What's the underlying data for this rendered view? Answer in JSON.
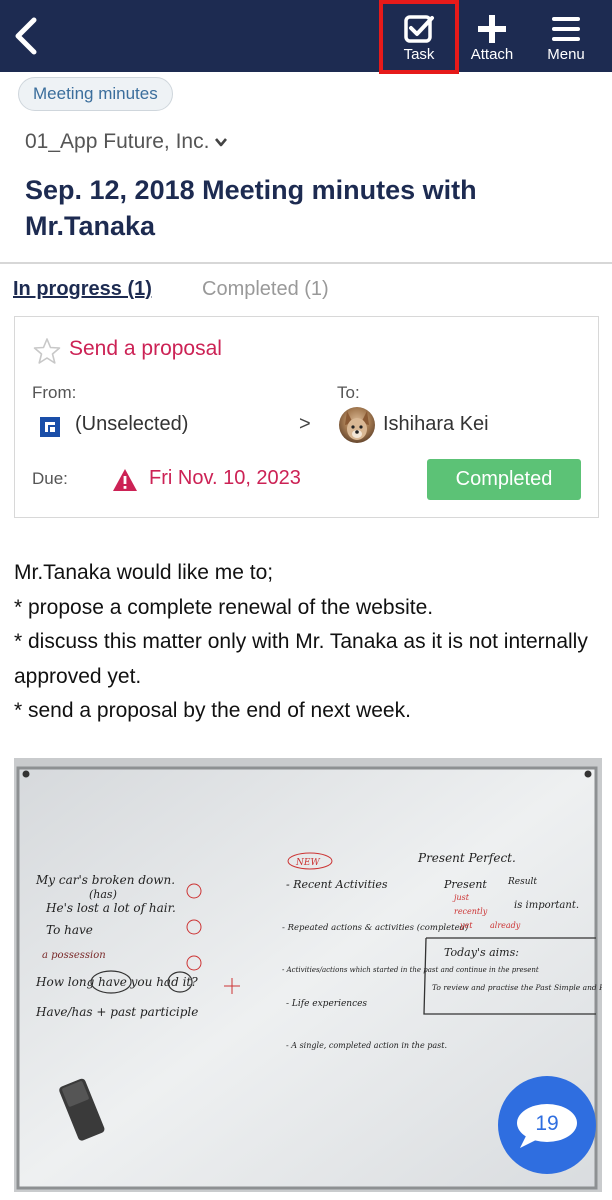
{
  "header": {
    "back_icon": "chevron-left-icon",
    "task_label": "Task",
    "attach_label": "Attach",
    "menu_label": "Menu",
    "background_color": "#1d2b51",
    "highlight_color": "#e61a1a"
  },
  "tag": "Meeting minutes",
  "company": "01_App Future, Inc.",
  "title": "Sep. 12, 2018 Meeting minutes with Mr.Tanaka",
  "tabs": {
    "in_progress": "In progress (1)",
    "completed": "Completed (1)"
  },
  "task": {
    "title": "Send a proposal",
    "from_label": "From:",
    "from_value": "(Unselected)",
    "arrow": ">",
    "to_label": "To:",
    "to_value": "Ishihara Kei",
    "due_label": "Due:",
    "due_value": "Fri Nov. 10, 2023",
    "status_button": "Completed",
    "status_color": "#5cc276",
    "accent_color": "#cc2255"
  },
  "body": {
    "lines": [
      "Mr.Tanaka would like me to;",
      "* propose a complete renewal of the website.",
      "* discuss this matter only with Mr. Tanaka as it is not internally approved yet.",
      "* send a proposal by the end of next week."
    ]
  },
  "whiteboard": {
    "left_notes": [
      "My car's broken down.",
      "(has)",
      "He's lost a lot of hair.",
      "To have",
      "a possession",
      "How long have you had it?",
      "Have/has + past participle"
    ],
    "middle_notes": [
      "NEW",
      "- Recent Activities",
      "- Repeated actions & activities (completed)",
      "- Activities/actions which started in the past and continue in the present",
      "- Life experiences",
      "- A single, completed action in the past."
    ],
    "right_notes": [
      "Present Perfect.",
      "Present",
      "Result",
      "is important.",
      "just",
      "recently",
      "yet",
      "already",
      "Today's aims:",
      "To review and practise the Past Simple and Present Perfect"
    ]
  },
  "comments": {
    "count": "19",
    "fab_color": "#2f6ee0"
  }
}
